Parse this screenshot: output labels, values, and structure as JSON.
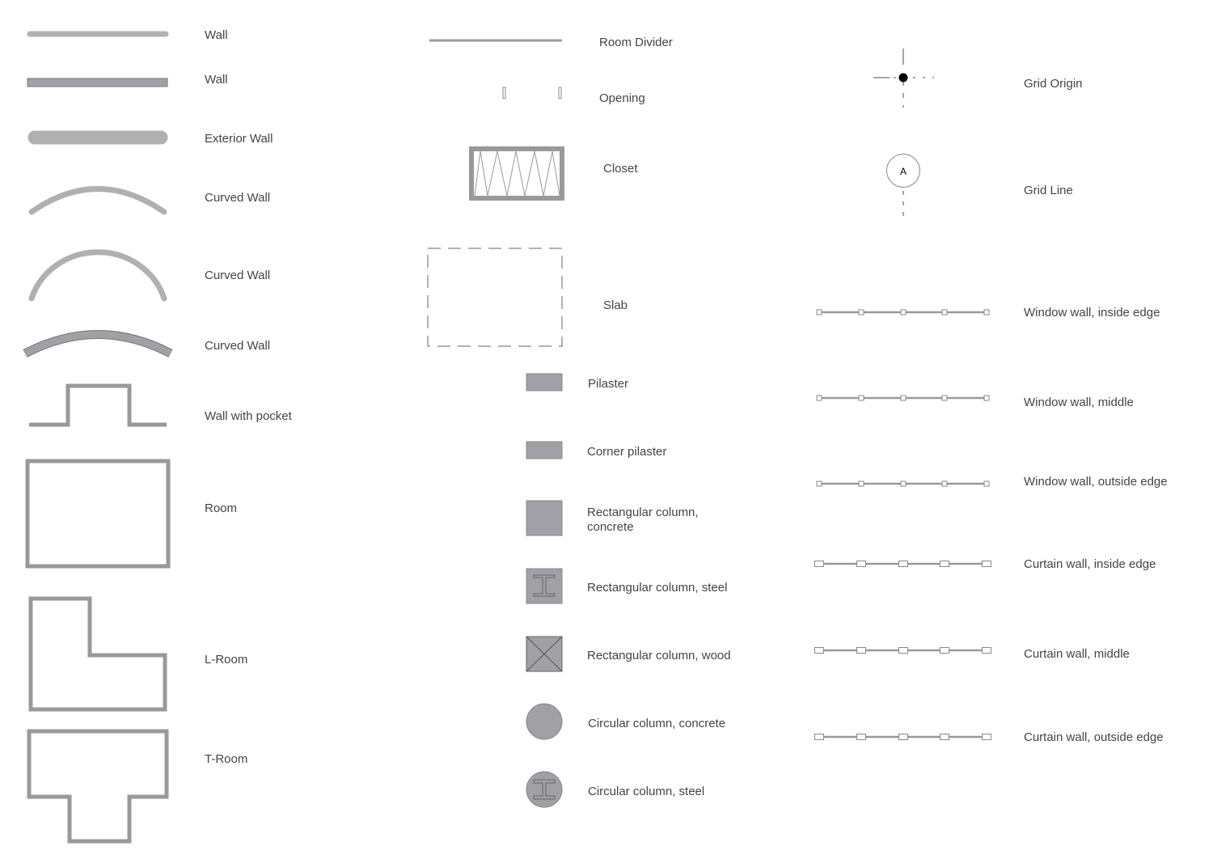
{
  "colors": {
    "light_wall": "#b0b0b0",
    "dark_fill": "#a0a0a6",
    "outline": "#999999",
    "text": "#444444"
  },
  "left_column": [
    {
      "label": "Wall",
      "icon": "wall-thin"
    },
    {
      "label": "Wall",
      "icon": "wall-rect"
    },
    {
      "label": "Exterior Wall",
      "icon": "exterior-wall"
    },
    {
      "label": "Curved Wall",
      "icon": "curved-wall-shallow"
    },
    {
      "label": "Curved Wall",
      "icon": "curved-wall-deep"
    },
    {
      "label": "Curved Wall",
      "icon": "curved-wall-thick"
    },
    {
      "label": "Wall with pocket",
      "icon": "wall-pocket"
    },
    {
      "label": "Room",
      "icon": "room"
    },
    {
      "label": "L-Room",
      "icon": "l-room"
    },
    {
      "label": "T-Room",
      "icon": "t-room"
    }
  ],
  "middle_column": [
    {
      "label": "Room Divider",
      "icon": "room-divider"
    },
    {
      "label": "Opening",
      "icon": "opening"
    },
    {
      "label": "Closet",
      "icon": "closet"
    },
    {
      "label": "Slab",
      "icon": "slab"
    },
    {
      "label": "Pilaster",
      "icon": "pilaster"
    },
    {
      "label": "Corner pilaster",
      "icon": "corner-pilaster"
    },
    {
      "label": "Rectangular column,\nconcrete",
      "icon": "rect-column-concrete"
    },
    {
      "label": "Rectangular column, steel",
      "icon": "rect-column-steel"
    },
    {
      "label": "Rectangular column, wood",
      "icon": "rect-column-wood"
    },
    {
      "label": "Circular column, concrete",
      "icon": "circ-column-concrete"
    },
    {
      "label": "Circular column, steel",
      "icon": "circ-column-steel"
    }
  ],
  "right_column": [
    {
      "label": "Grid Origin",
      "icon": "grid-origin"
    },
    {
      "label": "Grid Line",
      "icon": "grid-line",
      "bubble_text": "A"
    },
    {
      "label": "Window wall, inside edge",
      "icon": "window-wall"
    },
    {
      "label": "Window wall, middle",
      "icon": "window-wall"
    },
    {
      "label": "Window wall, outside edge",
      "icon": "window-wall"
    },
    {
      "label": "Curtain wall, inside edge",
      "icon": "curtain-wall"
    },
    {
      "label": "Curtain wall, middle",
      "icon": "curtain-wall"
    },
    {
      "label": "Curtain wall, outside edge",
      "icon": "curtain-wall"
    }
  ]
}
